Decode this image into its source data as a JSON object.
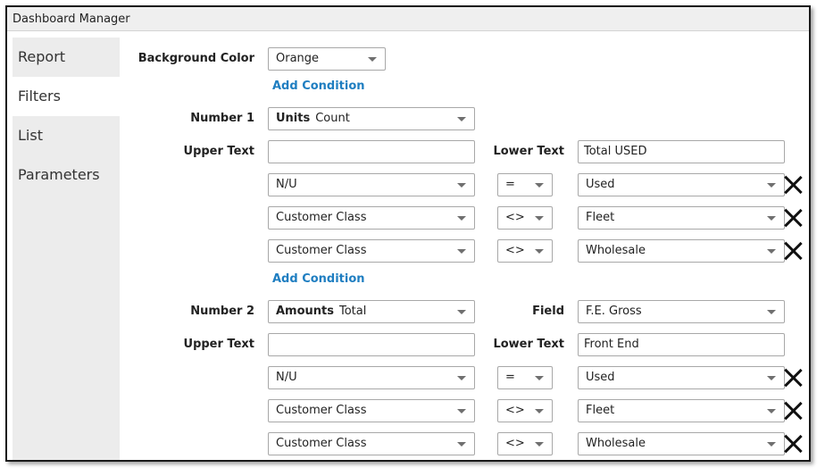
{
  "window": {
    "title": "Dashboard Manager"
  },
  "sidebar": {
    "items": [
      {
        "label": "Report"
      },
      {
        "label": "Filters"
      },
      {
        "label": "List"
      },
      {
        "label": "Parameters"
      }
    ],
    "active": "Filters"
  },
  "background": {
    "label": "Background Color",
    "value": "Orange",
    "add_condition": "Add Condition"
  },
  "number1": {
    "label": "Number 1",
    "field_bold": "Units",
    "field_value": "Count",
    "upper_text_label": "Upper Text",
    "upper_text_value": "",
    "lower_text_label": "Lower Text",
    "lower_text_value": "Total USED",
    "conditions": [
      {
        "field": "N/U",
        "op": "=",
        "value": "Used"
      },
      {
        "field": "Customer Class",
        "op": "<>",
        "value": "Fleet"
      },
      {
        "field": "Customer Class",
        "op": "<>",
        "value": "Wholesale"
      }
    ],
    "add_condition": "Add Condition"
  },
  "number2": {
    "label": "Number 2",
    "field_bold": "Amounts",
    "field_value": "Total",
    "field_label": "Field",
    "field_select": "F.E. Gross",
    "upper_text_label": "Upper Text",
    "upper_text_value": "",
    "lower_text_label": "Lower Text",
    "lower_text_value": "Front End",
    "conditions": [
      {
        "field": "N/U",
        "op": "=",
        "value": "Used"
      },
      {
        "field": "Customer Class",
        "op": "<>",
        "value": "Fleet"
      },
      {
        "field": "Customer Class",
        "op": "<>",
        "value": "Wholesale"
      }
    ]
  }
}
